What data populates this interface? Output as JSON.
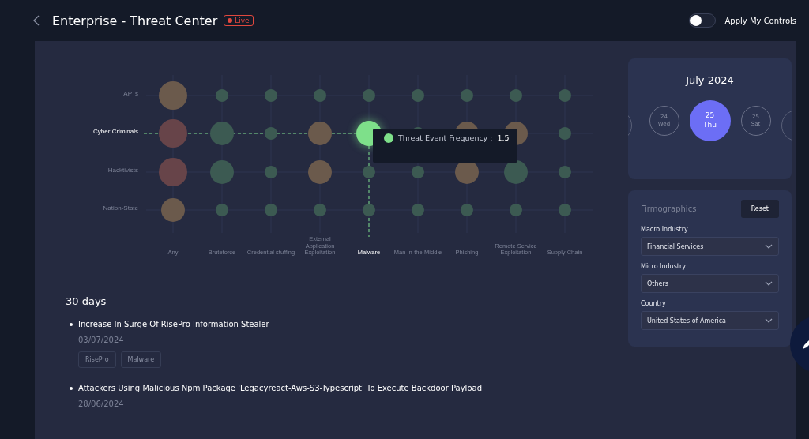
{
  "header": {
    "title": "Enterprise - Threat Center",
    "badge": "Live",
    "toggle": {
      "label": "Apply My Controls",
      "on": false
    }
  },
  "matrix": {
    "rows": [
      {
        "label": "APTs",
        "selected": false,
        "cells": [
          {
            "kind": "large",
            "color": "#6b5a4c"
          },
          {
            "kind": "small",
            "color": "#3c5a52"
          },
          {
            "kind": "small",
            "color": "#3c5a52"
          },
          {
            "kind": "small",
            "color": "#3c5a52"
          },
          {
            "kind": "small",
            "color": "#3c5a52"
          },
          {
            "kind": "small",
            "color": "#3c5a52"
          },
          {
            "kind": "small",
            "color": "#3c5a52"
          },
          {
            "kind": "small",
            "color": "#3c5a52"
          },
          {
            "kind": "small",
            "color": "#3c5a52"
          }
        ]
      },
      {
        "label": "Cyber Criminals",
        "selected": true,
        "cells": [
          {
            "kind": "large",
            "color": "#674449"
          },
          {
            "kind": "medium",
            "color": "#3c5a52"
          },
          {
            "kind": "small",
            "color": "#3c5a52"
          },
          {
            "kind": "medium",
            "color": "#6b5a4c"
          },
          {
            "kind": "highlight",
            "color": "#7ee08a"
          },
          {
            "kind": "small",
            "color": "#3c5a52"
          },
          {
            "kind": "medium",
            "color": "#6b5a4c"
          },
          {
            "kind": "medium",
            "color": "#6b5a4c"
          },
          {
            "kind": "small",
            "color": "#3c5a52"
          }
        ]
      },
      {
        "label": "Hacktivists",
        "selected": false,
        "cells": [
          {
            "kind": "large",
            "color": "#674449"
          },
          {
            "kind": "medium",
            "color": "#3c5a52"
          },
          {
            "kind": "small",
            "color": "#3c5a52"
          },
          {
            "kind": "medium",
            "color": "#6b5a4c"
          },
          {
            "kind": "small",
            "color": "#3c5a52"
          },
          {
            "kind": "small",
            "color": "#3c5a52"
          },
          {
            "kind": "medium",
            "color": "#6b5a4c"
          },
          {
            "kind": "medium",
            "color": "#3c5a52"
          },
          {
            "kind": "small",
            "color": "#3c5a52"
          }
        ]
      },
      {
        "label": "Nation-State",
        "selected": false,
        "cells": [
          {
            "kind": "medium",
            "color": "#6b5a4c"
          },
          {
            "kind": "small",
            "color": "#3c5a52"
          },
          {
            "kind": "small",
            "color": "#3c5a52"
          },
          {
            "kind": "small",
            "color": "#3c5a52"
          },
          {
            "kind": "small",
            "color": "#3c5a52"
          },
          {
            "kind": "small",
            "color": "#3c5a52"
          },
          {
            "kind": "small",
            "color": "#3c5a52"
          },
          {
            "kind": "small",
            "color": "#3c5a52"
          },
          {
            "kind": "small",
            "color": "#3c5a52"
          }
        ]
      }
    ],
    "columns": [
      {
        "label": "Any",
        "selected": false
      },
      {
        "label": "Bruteforce",
        "selected": false
      },
      {
        "label": "Credential stuffing",
        "selected": false
      },
      {
        "label": "External Application Exploitation",
        "selected": false
      },
      {
        "label": "Malware",
        "selected": true
      },
      {
        "label": "Man-in-the-Middle",
        "selected": false
      },
      {
        "label": "Phishing",
        "selected": false
      },
      {
        "label": "Remote Service Exploitation",
        "selected": false
      },
      {
        "label": "Supply Chain",
        "selected": false
      }
    ],
    "tooltip": {
      "label": "Threat Event Frequency :",
      "value": "1.5",
      "color": "#7ee08a"
    }
  },
  "calendar": {
    "month": "July 2024",
    "days": [
      {
        "day": "24",
        "weekday": "Wed",
        "selected": false
      },
      {
        "day": "25",
        "weekday": "Thu",
        "selected": true
      },
      {
        "day": "25",
        "weekday": "Sat",
        "selected": false
      }
    ]
  },
  "firmographics": {
    "title": "Firmographics",
    "reset": "Reset",
    "fields": [
      {
        "label": "Macro Industry",
        "value": "Financial Services"
      },
      {
        "label": "Micro Industry",
        "value": "Others"
      },
      {
        "label": "Country",
        "value": "United States of America"
      }
    ]
  },
  "news": {
    "period": "30 days",
    "items": [
      {
        "title": "Increase In Surge Of RisePro Information Stealer",
        "date": "03/07/2024",
        "tags": [
          "RisePro",
          "Malware"
        ]
      },
      {
        "title": "Attackers Using Malicious Npm Package 'Legacyreact-Aws-S3-Typescript' To Execute Backdoor Payload",
        "date": "28/06/2024"
      }
    ]
  }
}
